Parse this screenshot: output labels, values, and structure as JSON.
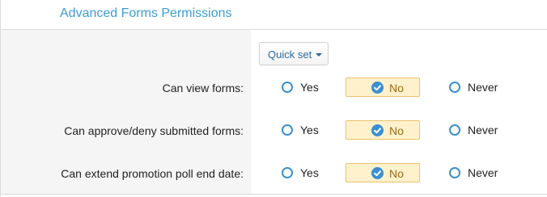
{
  "header": {
    "title": "Advanced Forms Permissions"
  },
  "quick_set": {
    "label": "Quick set"
  },
  "permissions": [
    {
      "label": "Can view forms:",
      "options": {
        "yes": "Yes",
        "no": "No",
        "never": "Never"
      },
      "selected": "No"
    },
    {
      "label": "Can approve/deny submitted forms:",
      "options": {
        "yes": "Yes",
        "no": "No",
        "never": "Never"
      },
      "selected": "No"
    },
    {
      "label": "Can extend promotion poll end date:",
      "options": {
        "yes": "Yes",
        "no": "No",
        "never": "Never"
      },
      "selected": "No"
    }
  ],
  "colors": {
    "title": "#3d9dd6",
    "radio": "#3b8fd0",
    "selected_bg": "#fff1cc",
    "selected_border": "#e9c26d"
  }
}
